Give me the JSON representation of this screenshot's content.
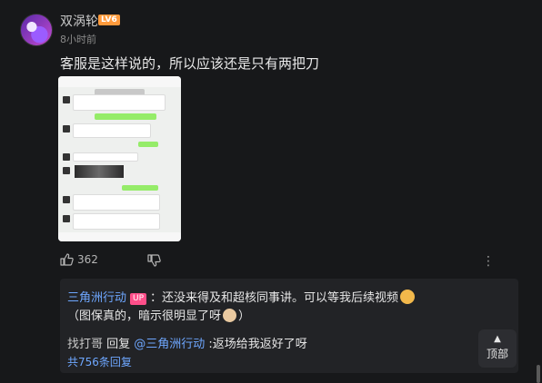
{
  "comment": {
    "username": "双涡轮",
    "level_badge": "LV6",
    "timestamp": "8小时前",
    "text": "客服是这样说的，所以应该还是只有两把刀",
    "likes": "362"
  },
  "reply_section": {
    "author_name": "三角洲行动",
    "up_badge": "UP",
    "author_text_before_emoji": "：还没来得及和超核同事讲。可以等我后续视频",
    "author_text_after_emoji": "（图保真的，暗示很明显了呀",
    "author_text_end": "）",
    "second_reply_name": "找打哥",
    "second_reply_verb": " 回复 ",
    "second_reply_mention": "@三角洲行动",
    "second_reply_text": " :返场给我返好了呀",
    "view_all_replies": "共756条回复"
  },
  "back_to_top": {
    "label": "顶部"
  },
  "icons": {
    "like": "thumbs-up-icon",
    "dislike": "thumbs-down-icon",
    "more": "more-dots-icon",
    "back_to_top": "chevron-up-icon"
  },
  "colors": {
    "link_blue": "#6ea7ff",
    "up_pink": "#ff4f8a",
    "level_orange": "#ff9a3c",
    "wechat_green": "#95ec69"
  }
}
